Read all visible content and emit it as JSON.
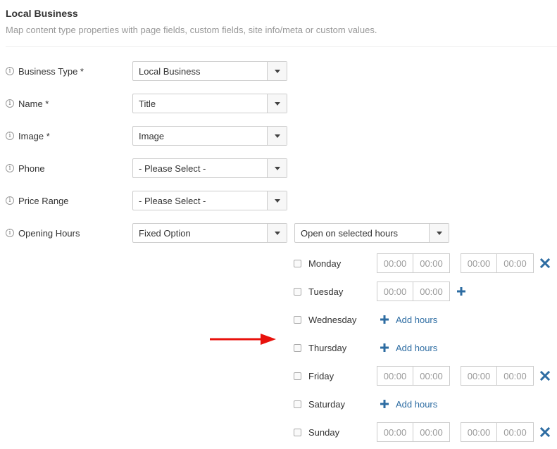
{
  "header": {
    "title": "Local Business",
    "subtitle": "Map content type properties with page fields, custom fields, site info/meta or custom values."
  },
  "fields": [
    {
      "label": "Business Type *",
      "value": "Local Business"
    },
    {
      "label": "Name *",
      "value": "Title"
    },
    {
      "label": "Image *",
      "value": "Image"
    },
    {
      "label": "Phone",
      "value": "- Please Select -"
    },
    {
      "label": "Price Range",
      "value": "- Please Select -"
    },
    {
      "label": "Opening Hours",
      "value": "Fixed Option"
    }
  ],
  "opening_hours_mode": "Open on selected hours",
  "info_icon_glyph": "i",
  "time_placeholder": "00:00",
  "add_hours_label": "Add hours",
  "days": [
    {
      "name": "Monday",
      "checked": false,
      "slots": 2,
      "action": "remove"
    },
    {
      "name": "Tuesday",
      "checked": false,
      "slots": 1,
      "action": "add"
    },
    {
      "name": "Wednesday",
      "checked": false,
      "slots": 0,
      "action": "add-hours"
    },
    {
      "name": "Thursday",
      "checked": false,
      "slots": 0,
      "action": "add-hours"
    },
    {
      "name": "Friday",
      "checked": false,
      "slots": 2,
      "action": "remove"
    },
    {
      "name": "Saturday",
      "checked": false,
      "slots": 0,
      "action": "add-hours"
    },
    {
      "name": "Sunday",
      "checked": false,
      "slots": 2,
      "action": "remove"
    }
  ],
  "colors": {
    "accent": "#2d6ca2",
    "arrow": "#e8120c"
  },
  "icons": {
    "remove": "close-icon",
    "add": "plus-icon",
    "dropdown": "chevron-down-icon",
    "annotation": "red-arrow-icon"
  }
}
